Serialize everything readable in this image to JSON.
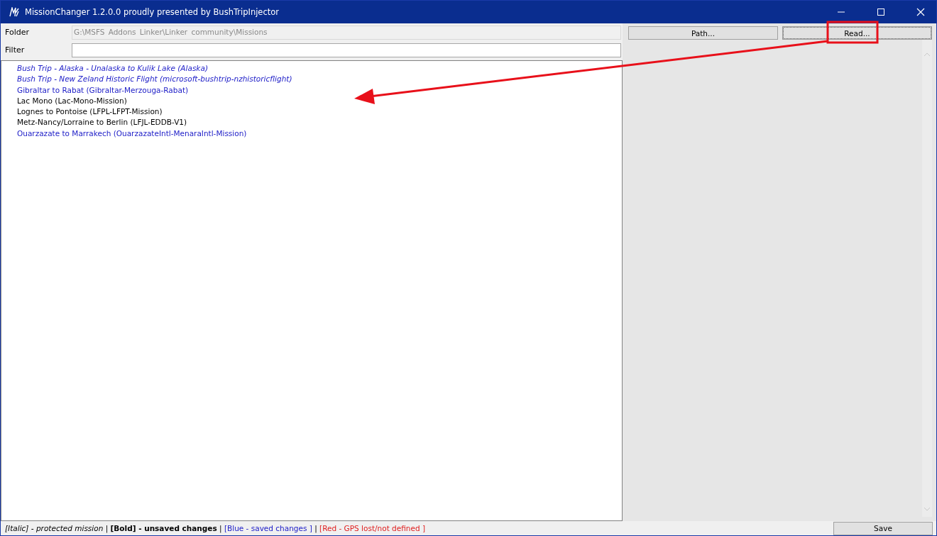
{
  "window": {
    "title": "MissionChanger 1.2.0.0 proudly presented by BushTripInjector"
  },
  "folder": {
    "label": "Folder",
    "value": "G:\\MSFS_Addons_Linker\\Linker_community\\Missions",
    "disabled": true
  },
  "filter": {
    "label": "Filter"
  },
  "buttons": {
    "path": "Path...",
    "read": "Read...",
    "save": "Save"
  },
  "missions": [
    {
      "name": "Bush Trip - Alaska - Unalaska to Kulik Lake (Alaska)",
      "protected": true,
      "saved": true
    },
    {
      "name": "Bush Trip - New Zeland Historic Flight (microsoft-bushtrip-nzhistoricflight)",
      "protected": true,
      "saved": true
    },
    {
      "name": "Gibraltar to Rabat (Gibraltar-Merzouga-Rabat)",
      "protected": false,
      "saved": true
    },
    {
      "name": "Lac Mono (Lac-Mono-Mission)",
      "protected": false,
      "saved": false
    },
    {
      "name": "Lognes to Pontoise (LFPL-LFPT-Mission)",
      "protected": false,
      "saved": false
    },
    {
      "name": "Metz-Nancy/Lorraine to Berlin (LFJL-EDDB-V1)",
      "protected": false,
      "saved": false
    },
    {
      "name": "Ouarzazate to Marrakech (OuarzazateIntl-MenaraIntl-Mission)",
      "protected": false,
      "saved": true
    }
  ],
  "legend": [
    {
      "text": "[Italic] - protected mission",
      "kind": "italic"
    },
    {
      "text": " | ",
      "kind": "separator"
    },
    {
      "text": "[Bold] - unsaved changes",
      "kind": "bold"
    },
    {
      "text": " | ",
      "kind": "separator"
    },
    {
      "text": "[Blue - saved changes ]",
      "kind": "blue"
    },
    {
      "text": " | ",
      "kind": "separator"
    },
    {
      "text": "[Red - GPS lost/not defined ]",
      "kind": "red"
    }
  ]
}
